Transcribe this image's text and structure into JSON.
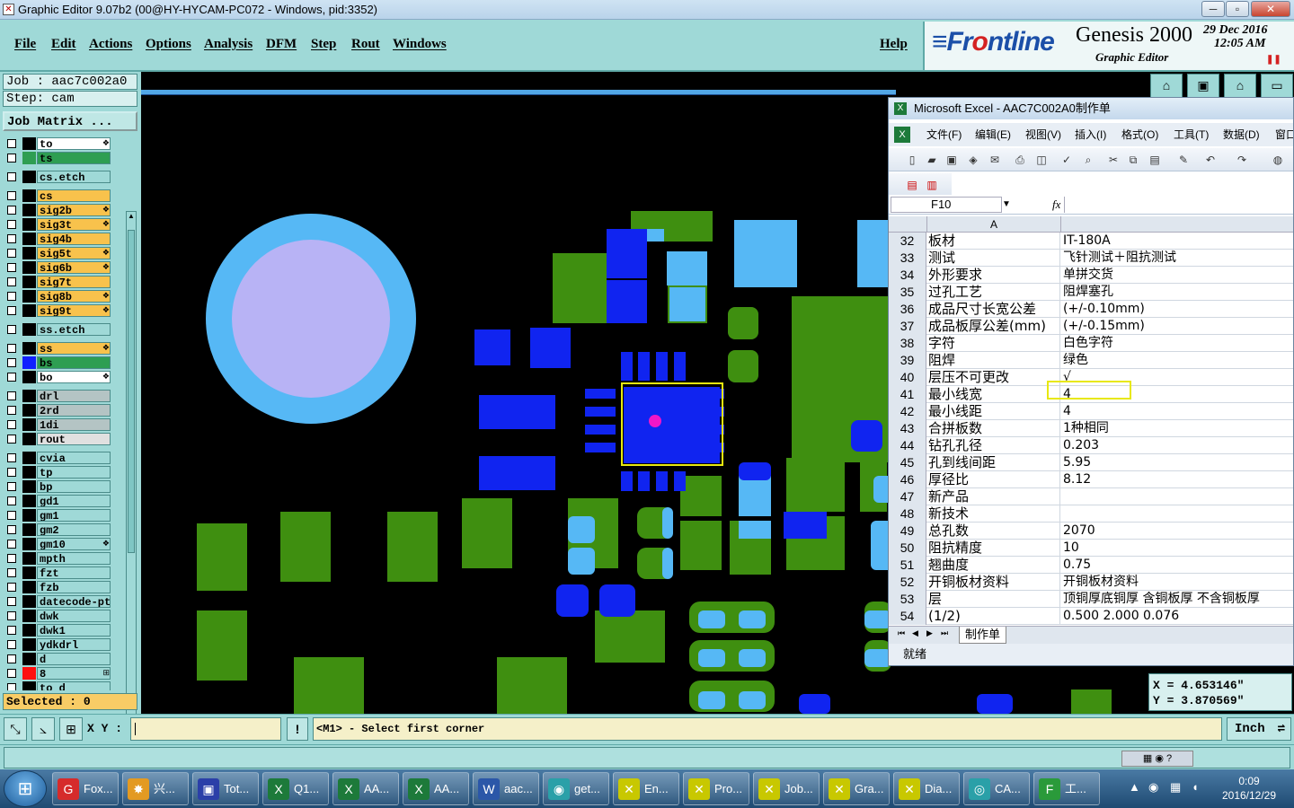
{
  "window": {
    "title": "Graphic Editor 9.07b2 (00@HY-HYCAM-PC072 - Windows, pid:3352)",
    "controls": [
      "─",
      "▫",
      "✕"
    ]
  },
  "menubar": {
    "items": [
      "File",
      "Edit",
      "Actions",
      "Options",
      "Analysis",
      "DFM",
      "Step",
      "Rout",
      "Windows"
    ],
    "help": "Help"
  },
  "brand": {
    "logo_left": "≡Fr",
    "logo_mid": "o",
    "logo_right": "ntline",
    "product": "Genesis 2000",
    "subtitle": "Graphic Editor",
    "date": "29 Dec 2016",
    "time": "12:05 AM"
  },
  "job": {
    "job_label": "Job  : aac7c002a0",
    "step_label": "Step: cam",
    "matrix_button": "Job Matrix ..."
  },
  "layers": [
    {
      "name": "to",
      "color": "#ffffff",
      "swatch": "#000000",
      "mark": "❖"
    },
    {
      "name": "ts",
      "color": "#2e9e52",
      "swatch": "#2e9e52",
      "mark": ""
    },
    {
      "name": "cs.etch",
      "color": "#9fd9d7",
      "swatch": "#000000",
      "mark": "",
      "gap": true
    },
    {
      "name": "cs",
      "color": "#f8c24c",
      "swatch": "#000000",
      "mark": "",
      "gap": true
    },
    {
      "name": "sig2b",
      "color": "#f8c24c",
      "swatch": "#000000",
      "mark": "❖"
    },
    {
      "name": "sig3t",
      "color": "#f8c24c",
      "swatch": "#000000",
      "mark": "❖"
    },
    {
      "name": "sig4b",
      "color": "#f8c24c",
      "swatch": "#000000",
      "mark": ""
    },
    {
      "name": "sig5t",
      "color": "#f8c24c",
      "swatch": "#000000",
      "mark": "❖"
    },
    {
      "name": "sig6b",
      "color": "#f8c24c",
      "swatch": "#000000",
      "mark": "❖"
    },
    {
      "name": "sig7t",
      "color": "#f8c24c",
      "swatch": "#000000",
      "mark": ""
    },
    {
      "name": "sig8b",
      "color": "#f8c24c",
      "swatch": "#000000",
      "mark": "❖"
    },
    {
      "name": "sig9t",
      "color": "#f8c24c",
      "swatch": "#000000",
      "mark": "❖"
    },
    {
      "name": "ss.etch",
      "color": "#9fd9d7",
      "swatch": "#000000",
      "mark": "",
      "gap": true
    },
    {
      "name": "ss",
      "color": "#f8c24c",
      "swatch": "#000000",
      "mark": "❖",
      "gap": true
    },
    {
      "name": "bs",
      "color": "#2e9e52",
      "swatch": "#1020ff",
      "mark": ""
    },
    {
      "name": "bo",
      "color": "#ffffff",
      "swatch": "#000000",
      "mark": "❖"
    },
    {
      "name": "drl",
      "color": "#b4c4c4",
      "swatch": "#000000",
      "mark": "",
      "gap": true
    },
    {
      "name": "2rd",
      "color": "#b4c4c4",
      "swatch": "#000000",
      "mark": ""
    },
    {
      "name": "1di",
      "color": "#b4c4c4",
      "swatch": "#000000",
      "mark": ""
    },
    {
      "name": "rout",
      "color": "#e0e0e0",
      "swatch": "#000000",
      "mark": ""
    },
    {
      "name": "cvia",
      "color": "#9fd9d7",
      "swatch": "#000000",
      "mark": "",
      "gap": true
    },
    {
      "name": "tp",
      "color": "#9fd9d7",
      "swatch": "#000000",
      "mark": ""
    },
    {
      "name": "bp",
      "color": "#9fd9d7",
      "swatch": "#000000",
      "mark": ""
    },
    {
      "name": "gd1",
      "color": "#9fd9d7",
      "swatch": "#000000",
      "mark": ""
    },
    {
      "name": "gm1",
      "color": "#9fd9d7",
      "swatch": "#000000",
      "mark": ""
    },
    {
      "name": "gm2",
      "color": "#9fd9d7",
      "swatch": "#000000",
      "mark": ""
    },
    {
      "name": "gm10",
      "color": "#9fd9d7",
      "swatch": "#000000",
      "mark": "❖"
    },
    {
      "name": "mpth",
      "color": "#9fd9d7",
      "swatch": "#000000",
      "mark": ""
    },
    {
      "name": "fzt",
      "color": "#9fd9d7",
      "swatch": "#000000",
      "mark": ""
    },
    {
      "name": "fzb",
      "color": "#9fd9d7",
      "swatch": "#000000",
      "mark": ""
    },
    {
      "name": "datecode-ptc",
      "color": "#9fd9d7",
      "swatch": "#000000",
      "mark": ""
    },
    {
      "name": "dwk",
      "color": "#9fd9d7",
      "swatch": "#000000",
      "mark": ""
    },
    {
      "name": "dwk1",
      "color": "#9fd9d7",
      "swatch": "#000000",
      "mark": ""
    },
    {
      "name": "ydkdrl",
      "color": "#9fd9d7",
      "swatch": "#000000",
      "mark": ""
    },
    {
      "name": "d",
      "color": "#9fd9d7",
      "swatch": "#000000",
      "mark": ""
    },
    {
      "name": "8",
      "color": "#9fd9d7",
      "swatch": "#ff1010",
      "mark": "⊞"
    },
    {
      "name": "to_d",
      "color": "#9fd9d7",
      "swatch": "#000000",
      "mark": ""
    }
  ],
  "selected": "Selected : 0",
  "bottombar": {
    "xy_label": "X Y :",
    "xy_value": "",
    "prompt": "<M1> - Select first corner",
    "units": "Inch"
  },
  "coordinates": {
    "x": "X  =  4.653146\"",
    "y": "Y  =  3.870569\""
  },
  "excel": {
    "title": "Microsoft Excel - AAC7C002A0制作单",
    "menu": [
      "文件(F)",
      "编辑(E)",
      "视图(V)",
      "插入(I)",
      "格式(O)",
      "工具(T)",
      "数据(D)",
      "窗口"
    ],
    "name_box": "F10",
    "fx": "fx",
    "column_a": "A",
    "rows": [
      {
        "n": "32",
        "a": "板材",
        "b": "IT-180A"
      },
      {
        "n": "33",
        "a": "测试",
        "b": "飞针测试＋阻抗测试"
      },
      {
        "n": "34",
        "a": "外形要求",
        "b": "单拼交货"
      },
      {
        "n": "35",
        "a": "过孔工艺",
        "b": "阻焊塞孔"
      },
      {
        "n": "36",
        "a": "成品尺寸长宽公差",
        "b": "(+/-0.10mm)"
      },
      {
        "n": "37",
        "a": "成品板厚公差(mm)",
        "b": "(+/-0.15mm)"
      },
      {
        "n": "38",
        "a": "字符",
        "b": "白色字符"
      },
      {
        "n": "39",
        "a": "阻焊",
        "b": "绿色"
      },
      {
        "n": "40",
        "a": "层压不可更改",
        "b": "√"
      },
      {
        "n": "41",
        "a": "最小线宽",
        "b": "4"
      },
      {
        "n": "42",
        "a": "最小线距",
        "b": "4"
      },
      {
        "n": "43",
        "a": "合拼板数",
        "b": "1种相同"
      },
      {
        "n": "44",
        "a": "钻孔孔径",
        "b": "0.203"
      },
      {
        "n": "45",
        "a": "孔到线间距",
        "b": "5.95"
      },
      {
        "n": "46",
        "a": "厚径比",
        "b": "8.12"
      },
      {
        "n": "47",
        "a": "新产品",
        "b": ""
      },
      {
        "n": "48",
        "a": "新技术",
        "b": ""
      },
      {
        "n": "49",
        "a": "总孔数",
        "b": "2070"
      },
      {
        "n": "50",
        "a": "阻抗精度",
        "b": "10"
      },
      {
        "n": "51",
        "a": "翘曲度",
        "b": "0.75"
      },
      {
        "n": "52",
        "a": "开铜板材资料",
        "b": "开铜板材资料"
      },
      {
        "n": "53",
        "a": "层",
        "b": "顶铜厚底铜厚 含铜板厚 不含铜板厚"
      },
      {
        "n": "54",
        "a": "(1/2)",
        "b": "0.500  2.000       0.076"
      }
    ],
    "sheet_tab": "制作单",
    "status": "就绪"
  },
  "taskbar": {
    "items": [
      {
        "label": "Fox...",
        "icon": "G",
        "color": "#d62b2b"
      },
      {
        "label": "兴...",
        "icon": "✸",
        "color": "#e39a22"
      },
      {
        "label": "Tot...",
        "icon": "▣",
        "color": "#2b3fa8"
      },
      {
        "label": "Q1...",
        "icon": "X",
        "color": "#1d7a3a"
      },
      {
        "label": "AA...",
        "icon": "X",
        "color": "#1d7a3a"
      },
      {
        "label": "AA...",
        "icon": "X",
        "color": "#1d7a3a"
      },
      {
        "label": "aac...",
        "icon": "W",
        "color": "#2b57a8"
      },
      {
        "label": "get...",
        "icon": "◉",
        "color": "#2aa0a8"
      },
      {
        "label": "En...",
        "icon": "✕",
        "color": "#c8c800"
      },
      {
        "label": "Pro...",
        "icon": "✕",
        "color": "#c8c800"
      },
      {
        "label": "Job...",
        "icon": "✕",
        "color": "#c8c800"
      },
      {
        "label": "Gra...",
        "icon": "✕",
        "color": "#c8c800"
      },
      {
        "label": "Dia...",
        "icon": "✕",
        "color": "#c8c800"
      },
      {
        "label": "CA...",
        "icon": "◎",
        "color": "#2aa0a8"
      },
      {
        "label": "工...",
        "icon": "F",
        "color": "#2a9a3a"
      }
    ],
    "time": "0:09",
    "date": "2016/12/29"
  }
}
